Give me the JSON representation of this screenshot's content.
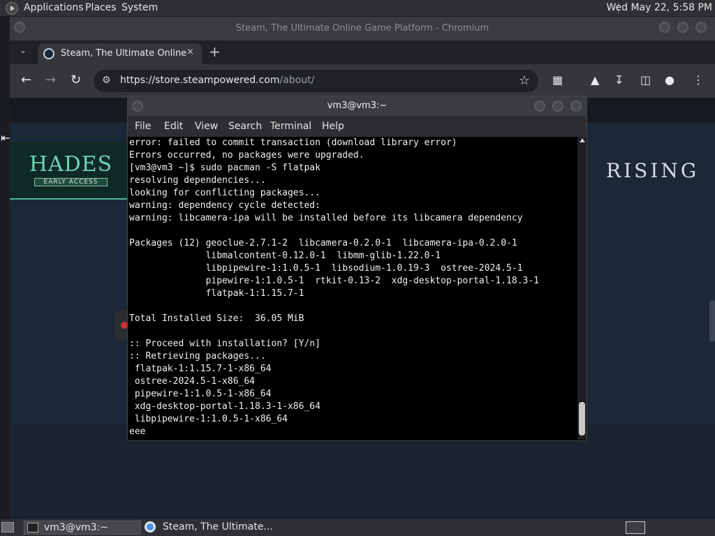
{
  "top_panel": {
    "menus": [
      "Applications",
      "Places",
      "System"
    ],
    "clock": "Wed May 22,  5:58 PM"
  },
  "browser": {
    "window_title": "Steam, The Ultimate Online Game Platform - Chromium",
    "tab": {
      "label": "Steam, The Ultimate Online",
      "close": "×"
    },
    "new_tab": "+",
    "url": {
      "host": "https://store.steampowered.com",
      "path": "/about/"
    },
    "page": {
      "hades_title": "HADES",
      "hades_sub": "EARLY ACCESS",
      "rising": "RISING"
    }
  },
  "terminal": {
    "title": "vm3@vm3:~",
    "menu": [
      "File",
      "Edit",
      "View",
      "Search",
      "Terminal",
      "Help"
    ],
    "lines": [
      "error: failed to commit transaction (download library error)",
      "Errors occurred, no packages were upgraded.",
      "[vm3@vm3 ~]$ sudo pacman -S flatpak",
      "resolving dependencies...",
      "looking for conflicting packages...",
      "warning: dependency cycle detected:",
      "warning: libcamera-ipa will be installed before its libcamera dependency",
      "",
      "Packages (12) geoclue-2.7.1-2  libcamera-0.2.0-1  libcamera-ipa-0.2.0-1",
      "              libmalcontent-0.12.0-1  libmm-glib-1.22.0-1",
      "              libpipewire-1:1.0.5-1  libsodium-1.0.19-3  ostree-2024.5-1",
      "              pipewire-1:1.0.5-1  rtkit-0.13-2  xdg-desktop-portal-1.18.3-1",
      "              flatpak-1:1.15.7-1",
      "",
      "Total Installed Size:  36.05 MiB",
      "",
      ":: Proceed with installation? [Y/n]",
      ":: Retrieving packages...",
      " flatpak-1:1.15.7-1-x86_64",
      " ostree-2024.5-1-x86_64",
      " pipewire-1:1.0.5-1-x86_64",
      " xdg-desktop-portal-1.18.3-1-x86_64",
      " libpipewire-1:1.0.5-1-x86_64",
      "eee"
    ]
  },
  "taskbar": {
    "tasks": [
      "vm3@vm3:~",
      "Steam, The Ultimate..."
    ]
  }
}
